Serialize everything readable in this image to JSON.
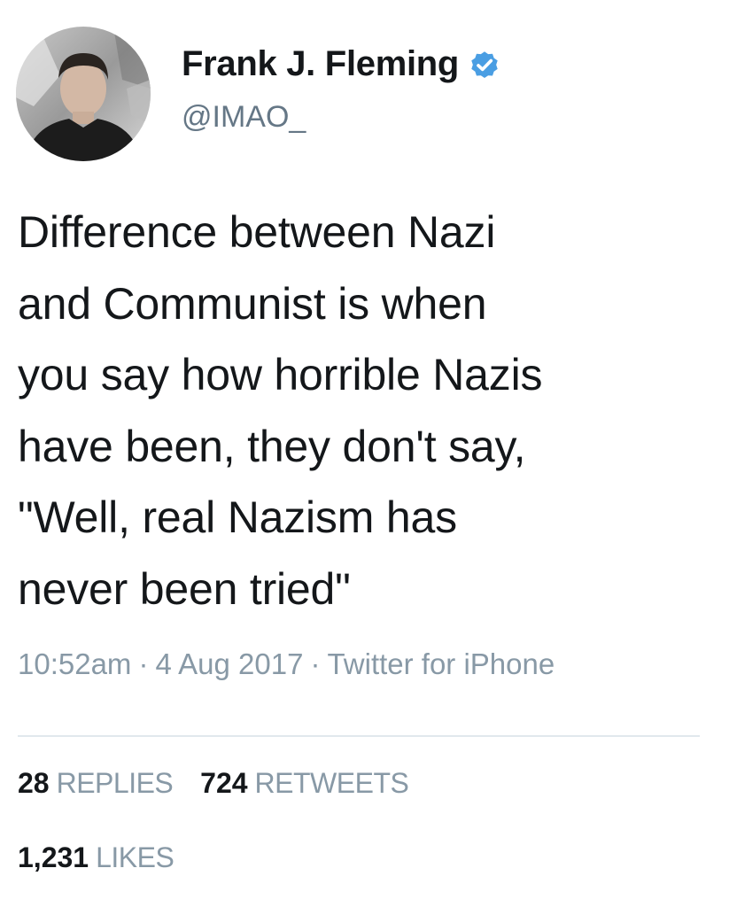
{
  "author": {
    "name": "Frank J. Fleming",
    "handle": "@IMAO_",
    "verified": true
  },
  "tweet": {
    "text": "Difference between Nazi\nand Communist is when\nyou say how horrible Nazis\nhave been, they don't say,\n\"Well, real Nazism has\nnever been tried\"",
    "time": "10:52am",
    "date": "4 Aug 2017",
    "source": "Twitter for iPhone",
    "separator": "·"
  },
  "stats": {
    "replies": {
      "count": "28",
      "label": "REPLIES"
    },
    "retweets": {
      "count": "724",
      "label": "RETWEETS"
    },
    "likes": {
      "count": "1,231",
      "label": "LIKES"
    }
  },
  "colors": {
    "verified_badge": "#4a9ee3",
    "secondary_text": "#8899a6",
    "primary_text": "#14171a",
    "divider": "#e1e8ed"
  },
  "icons": {
    "verified": "verified-badge-icon"
  }
}
